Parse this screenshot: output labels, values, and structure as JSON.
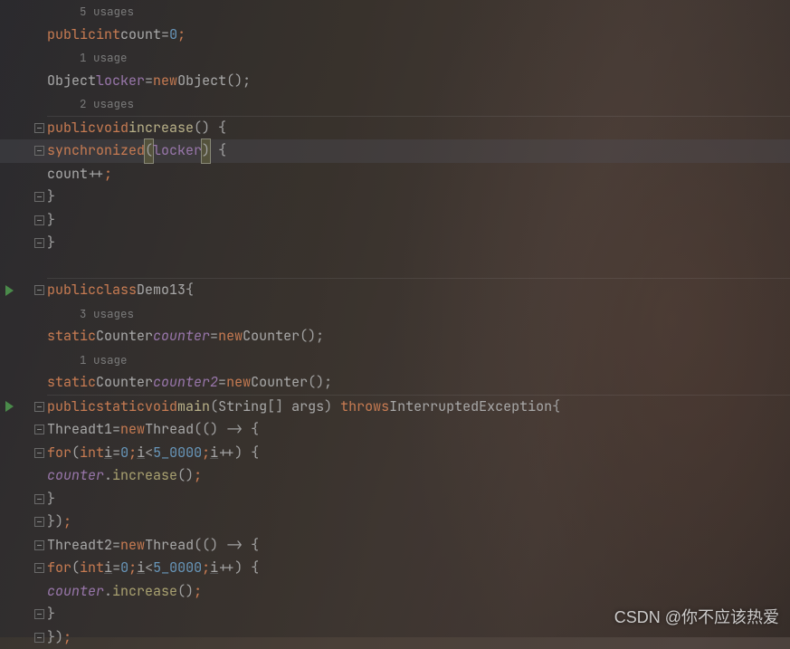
{
  "usages": {
    "u5": "5 usages",
    "u1a": "1 usage",
    "u2": "2 usages",
    "u3": "3 usages",
    "u1b": "1 usage"
  },
  "kw": {
    "public": "public",
    "int": "int",
    "new": "new",
    "void": "void",
    "synchronized": "synchronized",
    "class": "class",
    "static": "static",
    "throws": "throws",
    "for": "for"
  },
  "id": {
    "count": "count",
    "locker": "locker",
    "increase": "increase",
    "Object": "Object",
    "Demo13": "Demo13",
    "Counter": "Counter",
    "counter": "counter",
    "counter2": "counter2",
    "main": "main",
    "String": "String",
    "args": "args",
    "InterruptedException": "InterruptedException",
    "Thread": "Thread",
    "t1": "t1",
    "t2": "t2",
    "i": "i"
  },
  "num": {
    "zero": "0",
    "loop": "5_0000"
  },
  "watermark": "CSDN @你不应该热爱"
}
